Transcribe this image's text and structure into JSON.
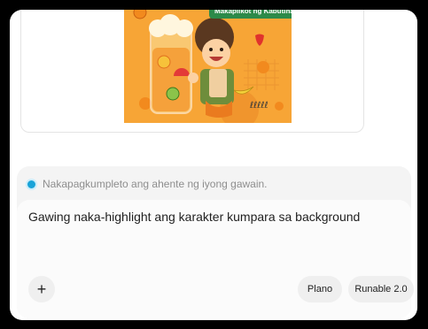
{
  "preview": {
    "badge": "Makapilkot ng Kabutihan!"
  },
  "status": {
    "text": "Nakapagkumpleto ang ahente ng iyong gawain.",
    "color": "#19a3d8"
  },
  "input": {
    "value": "Gawing naka-highlight ang karakter kumpara sa background"
  },
  "actions": {
    "attach_symbol": "+",
    "plan_label": "Plano",
    "model_label": "Runable 2.0"
  }
}
